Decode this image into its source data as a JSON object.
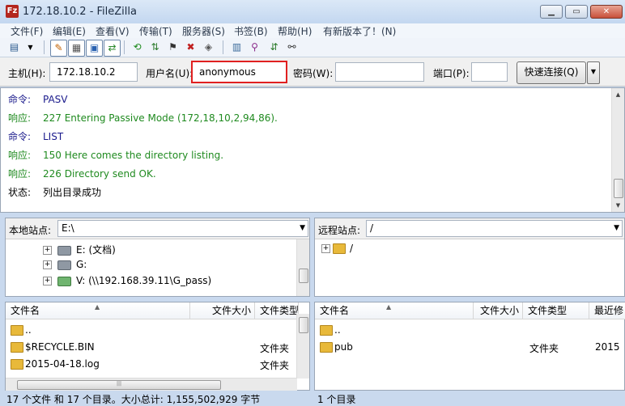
{
  "window": {
    "title": "172.18.10.2 - FileZilla",
    "app_icon": "Fz"
  },
  "menu": [
    "文件(F)",
    "编辑(E)",
    "查看(V)",
    "传输(T)",
    "服务器(S)",
    "书签(B)",
    "帮助(H)",
    "有新版本了！(N)"
  ],
  "quickconnect": {
    "host_label": "主机(H):",
    "host_value": "172.18.10.2",
    "user_label": "用户名(U):",
    "user_value": "anonymous",
    "pass_label": "密码(W):",
    "pass_value": "",
    "port_label": "端口(P):",
    "port_value": "",
    "button_label": "快速连接(Q)"
  },
  "log": [
    {
      "kind": "命令:",
      "text": "PASV",
      "type": "cmd"
    },
    {
      "kind": "响应:",
      "text": "227 Entering Passive Mode (172,18,10,2,94,86).",
      "type": "resp"
    },
    {
      "kind": "命令:",
      "text": "LIST",
      "type": "cmd"
    },
    {
      "kind": "响应:",
      "text": "150 Here comes the directory listing.",
      "type": "resp"
    },
    {
      "kind": "响应:",
      "text": "226 Directory send OK.",
      "type": "resp"
    },
    {
      "kind": "状态:",
      "text": "列出目录成功",
      "type": "stat"
    }
  ],
  "local": {
    "site_label": "本地站点:",
    "site_path": "E:\\",
    "tree": [
      {
        "label": "E: (文档)",
        "icon": "drive-icon"
      },
      {
        "label": "G:",
        "icon": "drive-icon"
      },
      {
        "label": "V: (\\\\192.168.39.11\\G_pass)",
        "icon": "network-drive-icon"
      }
    ],
    "columns": [
      "文件名",
      "文件大小",
      "文件类型"
    ],
    "files": [
      {
        "name": "..",
        "size": "",
        "type": ""
      },
      {
        "name": "$RECYCLE.BIN",
        "size": "",
        "type": "文件夹"
      },
      {
        "name": "2015-04-18.log",
        "size": "",
        "type": "文件夹"
      }
    ],
    "status": "17 个文件 和 17 个目录。大小总计: 1,155,502,929 字节"
  },
  "remote": {
    "site_label": "远程站点:",
    "site_path": "/",
    "tree": [
      {
        "label": "/",
        "icon": "folder-icon"
      }
    ],
    "columns": [
      "文件名",
      "文件大小",
      "文件类型",
      "最近修"
    ],
    "files": [
      {
        "name": "..",
        "size": "",
        "type": "",
        "modified": ""
      },
      {
        "name": "pub",
        "size": "",
        "type": "文件夹",
        "modified": "2015"
      }
    ],
    "status": "1 个目录"
  },
  "colors": {
    "log_command": "#1a1a8c",
    "log_response": "#1f8a1f",
    "highlight_border": "#e02020",
    "folder": "#e8b93a"
  }
}
